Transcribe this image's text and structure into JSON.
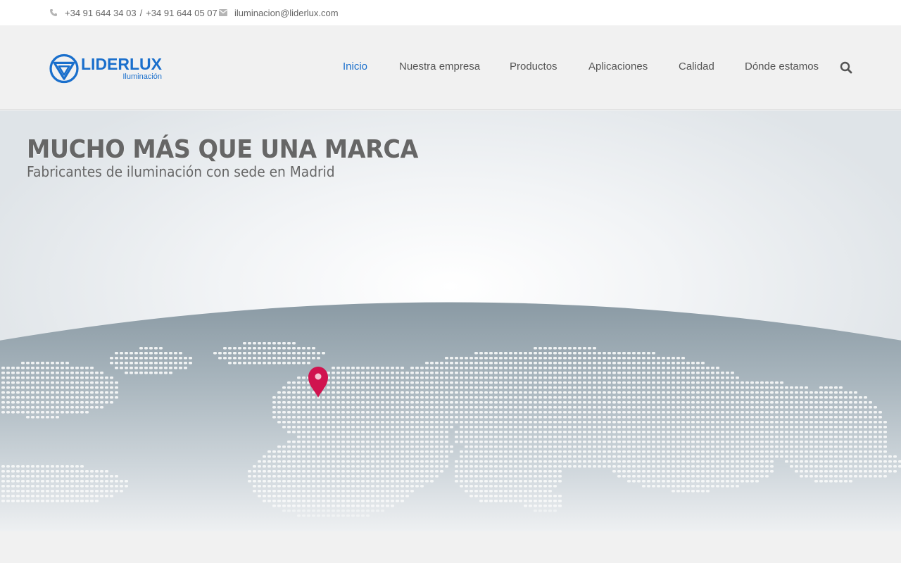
{
  "topbar": {
    "phone1": "+34 91 644 34 03",
    "separator": "/",
    "phone2": "+34 91 644 05 07",
    "email": "iluminacion@liderlux.com"
  },
  "brand": {
    "name": "LIDERLUX",
    "tagline": "Iluminación",
    "color": "#1a6fcc"
  },
  "nav": {
    "items": [
      {
        "label": "Inicio",
        "active": true
      },
      {
        "label": "Nuestra empresa",
        "active": false
      },
      {
        "label": "Productos",
        "active": false
      },
      {
        "label": "Aplicaciones",
        "active": false
      },
      {
        "label": "Calidad",
        "active": false
      },
      {
        "label": "Dónde estamos",
        "active": false
      }
    ],
    "search_icon": "search-icon"
  },
  "hero": {
    "title": "MUCHO MÁS QUE UNA MARCA",
    "subtitle": "Fabricantes de iluminación con sede en Madrid",
    "pin_color": "#d0134f"
  }
}
